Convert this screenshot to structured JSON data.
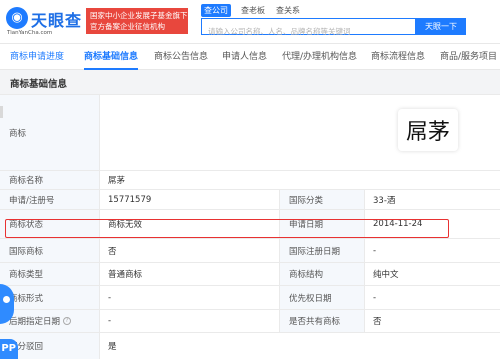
{
  "header": {
    "logo_text": "天眼查",
    "logo_domain": "TianYanCha.com",
    "badge_line1": "国家中小企业发展子基金旗下",
    "badge_line2": "官方备案企业征信机构",
    "search_tabs": [
      "查公司",
      "查老板",
      "查关系"
    ],
    "search_placeholder": "请输入公司名称、人名、品牌名称等关键词",
    "search_button": "天眼一下"
  },
  "nav": {
    "tabs": [
      "商标申请进度",
      "商标基础信息",
      "商标公告信息",
      "申请人信息",
      "代理/办理机构信息",
      "商标流程信息",
      "商品/服务项目"
    ],
    "active_index": 1
  },
  "section": {
    "title": "商标基础信息"
  },
  "trademark": {
    "image_label": "商标",
    "image_text": "屌茅",
    "rows": [
      {
        "l1": "商标名称",
        "v1": "屌茅",
        "l2": "",
        "v2": ""
      },
      {
        "l1": "申请/注册号",
        "v1": "15771579",
        "l2": "国际分类",
        "v2": "33-酒"
      },
      {
        "l1": "商标状态",
        "v1": "商标无效",
        "l2": "申请日期",
        "v2": "2014-11-24"
      },
      {
        "l1": "国际商标",
        "v1": "否",
        "l2": "国际注册日期",
        "v2": "-"
      },
      {
        "l1": "商标类型",
        "v1": "普通商标",
        "l2": "商标结构",
        "v2": "纯中文"
      },
      {
        "l1": "商标形式",
        "v1": "-",
        "l2": "优先权日期",
        "v2": "-"
      },
      {
        "l1": "后期指定日期",
        "v1": "-",
        "l2": "是否共有商标",
        "v2": "否"
      },
      {
        "l1": "部分驳回",
        "v1": "是",
        "l2": "",
        "v2": ""
      }
    ]
  },
  "floating": {
    "app_label": "PP"
  },
  "colors": {
    "brand_blue": "#1e7bff",
    "badge_red": "#e8473d",
    "highlight_red": "#e83232"
  }
}
